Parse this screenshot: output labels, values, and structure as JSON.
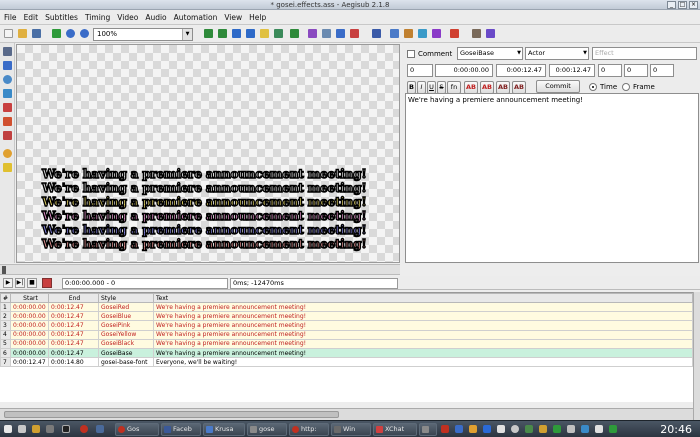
{
  "window": {
    "title": "* gosei.effects.ass - Aegisub 2.1.8"
  },
  "menu": [
    "File",
    "Edit",
    "Subtitles",
    "Timing",
    "Video",
    "Audio",
    "Automation",
    "View",
    "Help"
  ],
  "toolbar": {
    "zoom": "100%"
  },
  "video": {
    "subtitle_text": "We're having a premiere announcement meeting!",
    "line_colors": [
      "#e8e8e8",
      "#e8e8e8",
      "#f3e36a",
      "#f39ad8",
      "#8c8cf2",
      "#f39a9a"
    ]
  },
  "playback": {
    "time": "0:00:00.000 - 0",
    "offset": "0ms; -12470ms"
  },
  "edit_box": {
    "comment_label": "Comment",
    "style": "GoseiBase",
    "actor": "Actor",
    "effect_placeholder": "Effect",
    "layer": "0",
    "start": "0:00:00.00",
    "end": "0:00:12.47",
    "duration": "0:00:12.47",
    "margin_l": "0",
    "margin_r": "0",
    "margin_v": "0",
    "commit": "Commit",
    "time_label": "Time",
    "frame_label": "Frame",
    "format_buttons": [
      "B",
      "I",
      "U",
      "S",
      "fn",
      "AB",
      "AB",
      "AB",
      "AB"
    ],
    "text": "We're having a premiere announcement meeting!"
  },
  "grid": {
    "headers": [
      "#",
      "Start",
      "End",
      "Style",
      "Text"
    ],
    "rows": [
      {
        "n": "1",
        "start": "0:00:00.00",
        "end": "0:00:12.47",
        "style": "GoseiRed",
        "text": "We're having a premiere announcement meeting!"
      },
      {
        "n": "2",
        "start": "0:00:00.00",
        "end": "0:00:12.47",
        "style": "GoseiBlue",
        "text": "We're having a premiere announcement meeting!"
      },
      {
        "n": "3",
        "start": "0:00:00.00",
        "end": "0:00:12.47",
        "style": "GoseiPink",
        "text": "We're having a premiere announcement meeting!"
      },
      {
        "n": "4",
        "start": "0:00:00.00",
        "end": "0:00:12.47",
        "style": "GoseiYellow",
        "text": "We're having a premiere announcement meeting!"
      },
      {
        "n": "5",
        "start": "0:00:00.00",
        "end": "0:00:12.47",
        "style": "GoseiBlack",
        "text": "We're having a premiere announcement meeting!"
      },
      {
        "n": "6",
        "start": "0:00:00.00",
        "end": "0:00:12.47",
        "style": "GoseiBase",
        "text": "We're having a premiere announcement meeting!"
      },
      {
        "n": "7",
        "start": "0:00:12.47",
        "end": "0:00:14.80",
        "style": "gosei-base-font",
        "text": "Everyone, we'll be waiting!"
      }
    ]
  },
  "taskbar": {
    "items": [
      "Gos",
      "Faceb",
      "Krusa",
      "gose",
      "http:",
      "Win",
      "XChat",
      "gose"
    ],
    "clock": "20:46"
  }
}
